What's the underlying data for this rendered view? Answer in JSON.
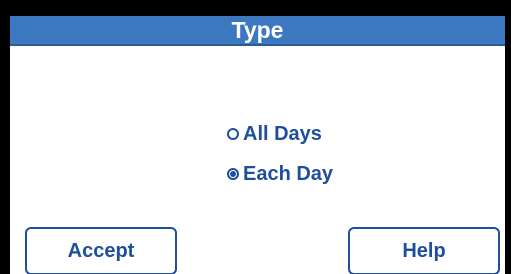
{
  "window": {
    "title": "Type"
  },
  "options": [
    {
      "label": "All Days",
      "selected": false
    },
    {
      "label": "Each Day",
      "selected": true
    }
  ],
  "buttons": {
    "accept_label": "Accept",
    "help_label": "Help"
  },
  "colors": {
    "title_bar": "#3c78c0",
    "accent": "#1f4e9c",
    "background": "#ffffff",
    "frame": "#000000"
  }
}
